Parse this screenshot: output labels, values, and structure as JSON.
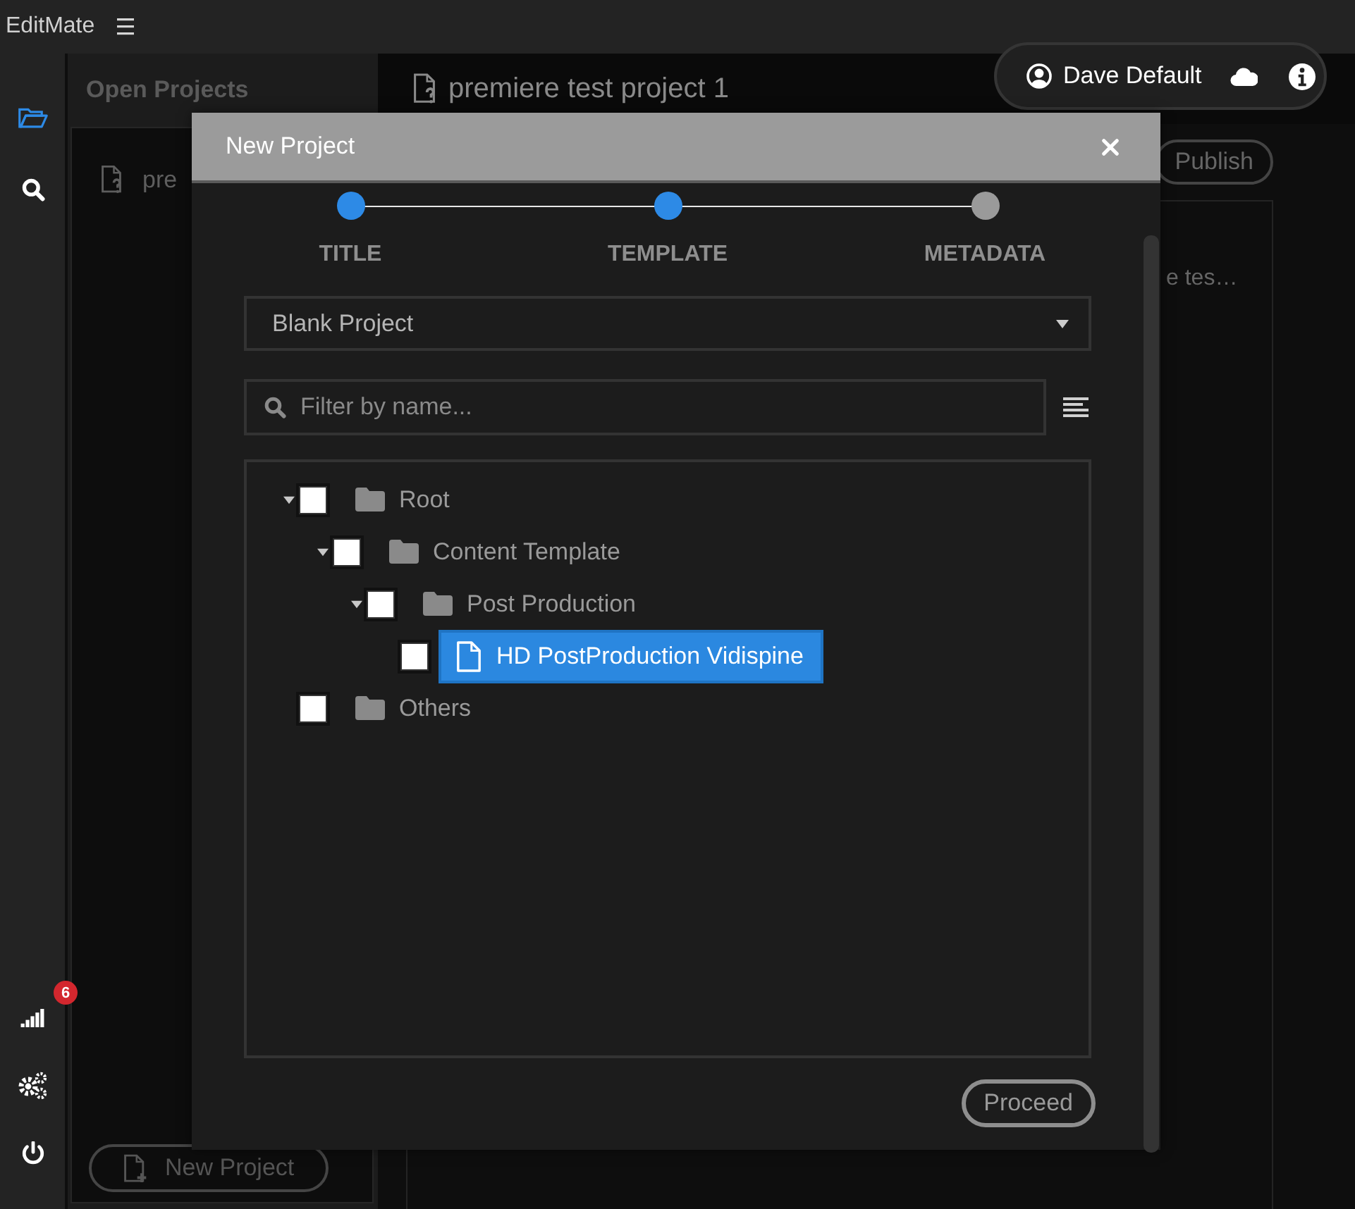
{
  "app": {
    "title": "EditMate"
  },
  "rail": {
    "items": [
      {
        "kind": "projects",
        "selected": true
      },
      {
        "kind": "search",
        "selected": false
      }
    ],
    "bottom_items": [
      {
        "kind": "signal",
        "badge": "6"
      },
      {
        "kind": "settings"
      },
      {
        "kind": "power"
      }
    ]
  },
  "open_projects": {
    "title": "Open Projects",
    "items": [
      "pre"
    ],
    "new_button": "New Project"
  },
  "main": {
    "title": "premiere test project 1",
    "publish_button": "Publish",
    "preview_text": "e tes…"
  },
  "user": {
    "name": "Dave Default"
  },
  "dialog": {
    "title": "New Project",
    "steps": [
      {
        "label": "TITLE",
        "done": true
      },
      {
        "label": "TEMPLATE",
        "done": true
      },
      {
        "label": "METADATA",
        "done": false
      }
    ],
    "template_select": {
      "value": "Blank Project"
    },
    "filter": {
      "placeholder": "Filter by name..."
    },
    "tree": [
      {
        "label": "Root",
        "kind": "folder",
        "expanded": true,
        "checked": false,
        "selected": false,
        "children": [
          {
            "label": "Content Template",
            "kind": "folder",
            "expanded": true,
            "checked": false,
            "selected": false,
            "children": [
              {
                "label": "Post Production",
                "kind": "folder",
                "expanded": true,
                "checked": false,
                "selected": false,
                "children": [
                  {
                    "label": "HD PostProduction Vidispine",
                    "kind": "file",
                    "checked": false,
                    "selected": true
                  }
                ]
              }
            ]
          }
        ]
      },
      {
        "label": "Others",
        "kind": "folder",
        "checked": false,
        "selected": false
      }
    ],
    "proceed_button": "Proceed"
  }
}
